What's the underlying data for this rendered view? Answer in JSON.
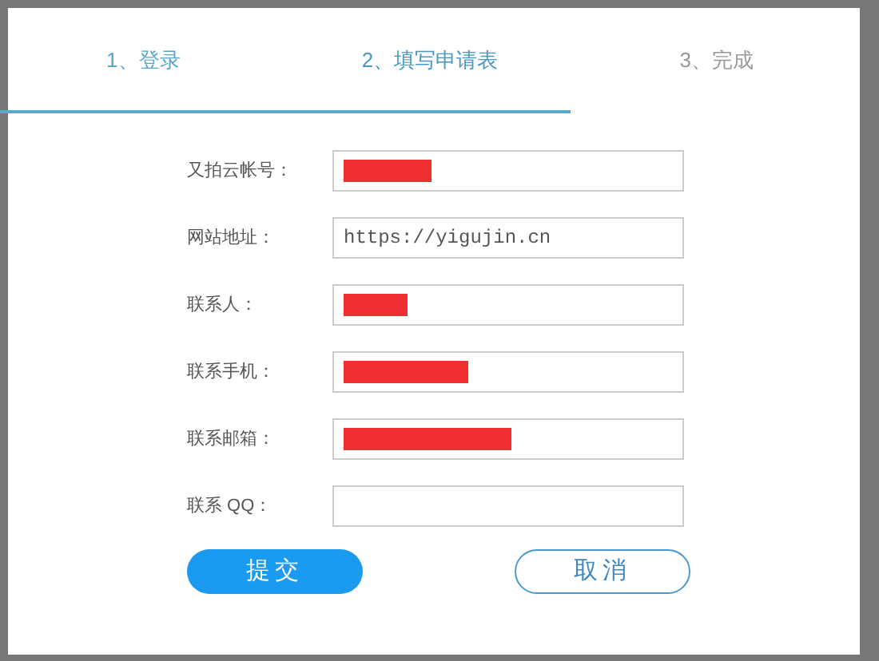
{
  "steps": [
    {
      "label": "1、登录",
      "selected": false
    },
    {
      "label": "2、填写申请表",
      "selected": true
    },
    {
      "label": "3、完成",
      "selected": false
    }
  ],
  "fields": [
    {
      "label": "又拍云帐号：",
      "redacted": true
    },
    {
      "label": "网站地址：",
      "value": "https://yigujin.cn",
      "redacted": false
    },
    {
      "label": "联系人：",
      "redacted": true
    },
    {
      "label": "联系手机：",
      "redacted": true
    },
    {
      "label": "联系邮箱：",
      "redacted": true
    },
    {
      "label": "联系 QQ：",
      "redacted": false
    }
  ],
  "buttons": [
    {
      "label": "提交",
      "kind": "primary"
    },
    {
      "label": "取消",
      "kind": "secondary"
    }
  ]
}
